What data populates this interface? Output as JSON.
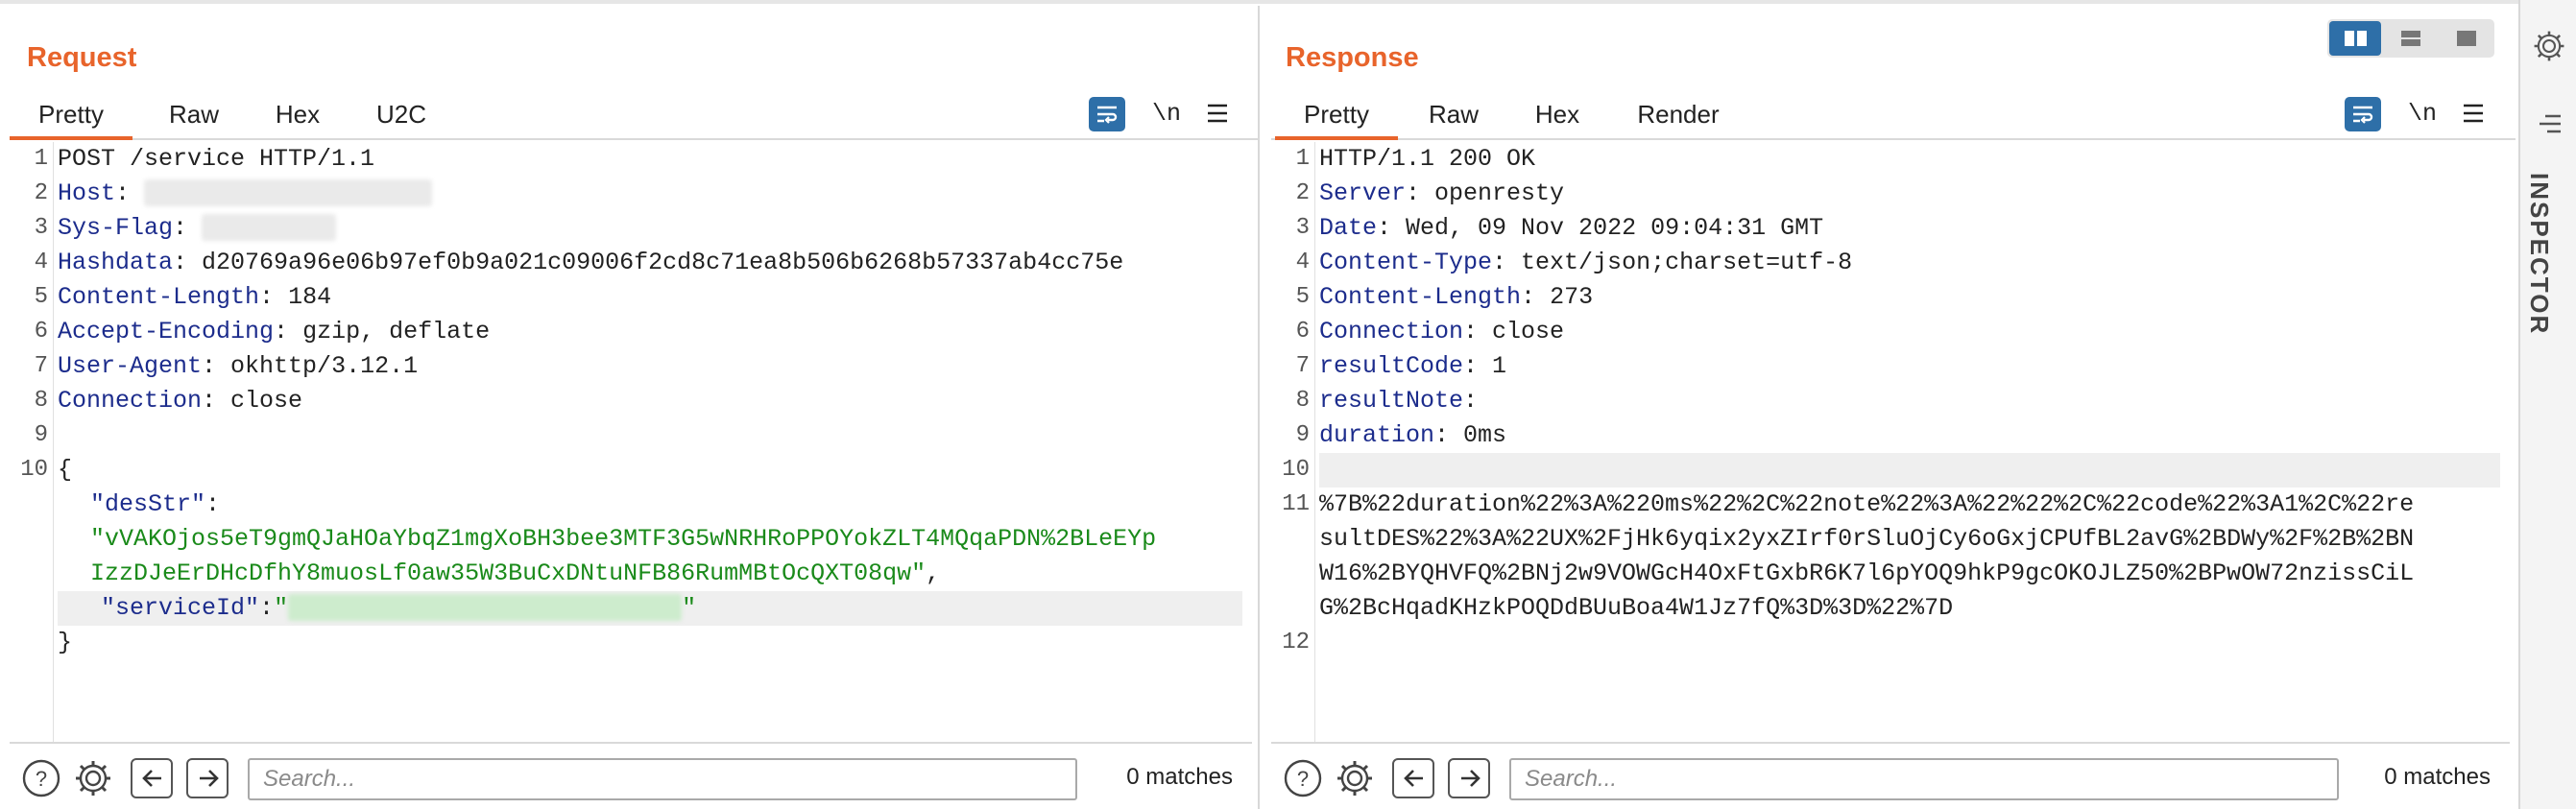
{
  "request": {
    "title": "Request",
    "tabs": [
      "Pretty",
      "Raw",
      "Hex",
      "U2C"
    ],
    "newline_label": "\\n",
    "lines": {
      "l1": "POST /service HTTP/1.1",
      "l2_key": "Host",
      "l3_key": "Sys-Flag",
      "l4_key": "Hashdata",
      "l4_val": "d20769a96e06b97ef0b9a021c09006f2cd8c71ea8b506b6268b57337ab4cc75e",
      "l5_key": "Content-Length",
      "l5_val": "184",
      "l6_key": "Accept-Encoding",
      "l6_val": "gzip, deflate",
      "l7_key": "User-Agent",
      "l7_val": "okhttp/3.12.1",
      "l8_key": "Connection",
      "l8_val": "close",
      "l10_open": "{",
      "desStr_key": "\"desStr\"",
      "desStr_val_1": "\"vVAKOjos5eT9gmQJaHOaYbqZ1mgXoBH3bee3MTF3G5wNRHRoPPOYokZLT4MQqaPDN%2BLeEYp",
      "desStr_val_2": "IzzDJeErDHcDfhY8muosLf0aw35W3BuCxDNtuNFB86RumMBtOcQXT08qw\"",
      "serviceId_key": "\"serviceId\"",
      "serviceId_tail": "\"",
      "close": "}"
    },
    "footer": {
      "search_placeholder": "Search...",
      "matches": "0 matches"
    }
  },
  "response": {
    "title": "Response",
    "tabs": [
      "Pretty",
      "Raw",
      "Hex",
      "Render"
    ],
    "newline_label": "\\n",
    "lines": {
      "l1": "HTTP/1.1 200 OK",
      "l2_key": "Server",
      "l2_val": "openresty",
      "l3_key": "Date",
      "l3_val": "Wed, 09 Nov 2022 09:04:31 GMT",
      "l4_key": "Content-Type",
      "l4_val": "text/json;charset=utf-8",
      "l5_key": "Content-Length",
      "l5_val": "273",
      "l6_key": "Connection",
      "l6_val": "close",
      "l7_key": "resultCode",
      "l7_val": "1",
      "l8_key": "resultNote",
      "l9_key": "duration",
      "l9_val": "0ms",
      "body_1": "%7B%22duration%22%3A%220ms%22%2C%22note%22%3A%22%22%2C%22code%22%3A1%2C%22re",
      "body_2": "sultDES%22%3A%22UX%2FjHk6yqix2yxZIrf0rSluOjCy6oGxjCPUfBL2avG%2BDWy%2F%2B%2BN",
      "body_3": "W16%2BYQHVFQ%2BNj2w9VOWGcH4OxFtGxbR6K7l6pYOQ9hkP9gcOKOJLZ50%2BPwOW72nzissCiL",
      "body_4": "G%2BcHqadKHzkPOQDdBUuBoa4W1Jz7fQ%3D%3D%22%7D"
    },
    "footer": {
      "search_placeholder": "Search...",
      "matches": "0 matches"
    }
  },
  "inspector": {
    "label": "INSPECTOR"
  },
  "colors": {
    "accent": "#e8642b",
    "button_blue": "#2e6fa8",
    "header_key": "#1c2c8c",
    "json_string": "#1a8a1a"
  }
}
